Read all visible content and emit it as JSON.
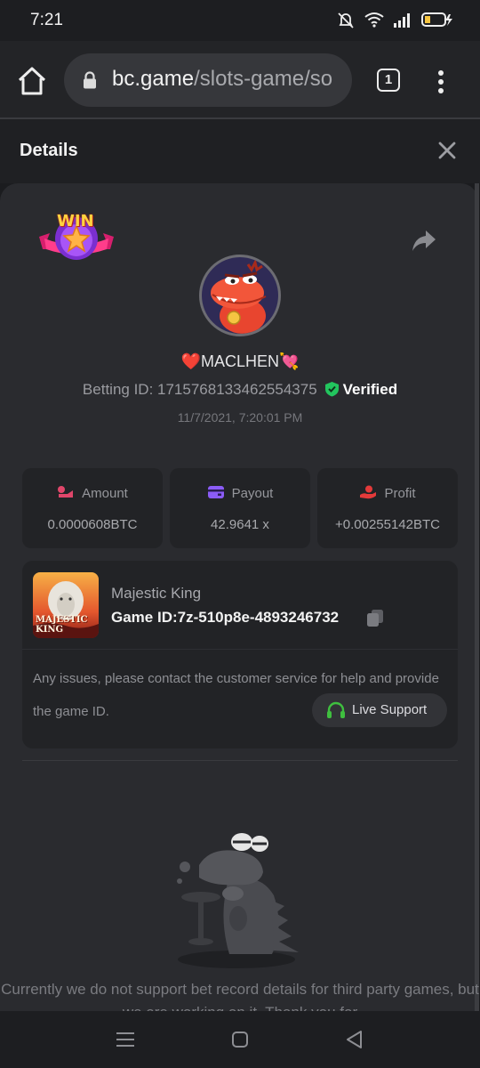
{
  "status_bar": {
    "time": "7:21"
  },
  "browser": {
    "url_domain": "bc.game",
    "url_path": "/slots-game/so",
    "tab_count": "1"
  },
  "details": {
    "title": "Details"
  },
  "bet": {
    "win_badge_text": "WIN",
    "username": "❤️MACLHEN💘",
    "betting_id_label": "Betting ID: 1715768133462554375",
    "verified_label": "Verified",
    "datetime": "11/7/2021, 7:20:01 PM"
  },
  "stats": [
    {
      "title": "Amount",
      "value": "0.0000608BTC",
      "icon": "coins-icon",
      "color": "#e0466a"
    },
    {
      "title": "Payout",
      "value": "42.9641 x",
      "icon": "wallet-icon",
      "color": "#8b5cf6"
    },
    {
      "title": "Profit",
      "value": "+0.00255142BTC",
      "icon": "hand-coin-icon",
      "color": "#e43a3a"
    }
  ],
  "game": {
    "name": "Majestic King",
    "game_id": "Game ID:7z-510p8e-4893246732",
    "thumb_text": "MAJESTIC KING"
  },
  "support": {
    "issue_text": "Any issues, please contact the customer service for help and provide the game ID.",
    "live_support_label": "Live Support"
  },
  "notice": {
    "text": "Currently we do not support bet record details for third party games, but we are working on it. Thank you for"
  },
  "colors": {
    "verified_green": "#22c55e",
    "support_green": "#3fbf3f"
  }
}
